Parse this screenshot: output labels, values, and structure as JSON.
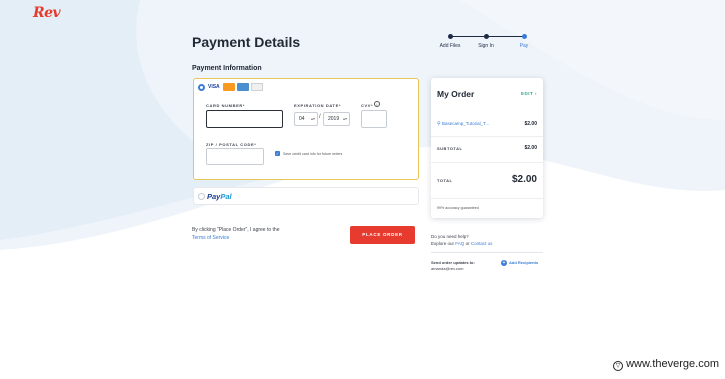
{
  "brand": {
    "logo_text": "Rev"
  },
  "steps": [
    {
      "label": "Add Files"
    },
    {
      "label": "Sign In"
    },
    {
      "label": "Pay"
    }
  ],
  "page": {
    "title": "Payment Details",
    "section": "Payment Information"
  },
  "card_form": {
    "card_brands": [
      "VISA",
      "mastercard",
      "amex",
      "discover"
    ],
    "card_number_label": "CARD NUMBER*",
    "expiration_label": "EXPIRATION DATE*",
    "exp_month": "04",
    "exp_year": "2019",
    "cvv_label": "CVV*",
    "zip_label": "ZIP / POSTAL CODE*",
    "save_label": "Save credit card info for future orders"
  },
  "paypal": {
    "pay": "Pay",
    "pal": "Pal"
  },
  "terms": {
    "text": "By clicking \"Place Order\", I agree to the",
    "link": "Terms of Service"
  },
  "place_order_label": "PLACE ORDER",
  "order": {
    "title": "My Order",
    "edit_label": "EDIT ›",
    "item_name": "Basecamp_Tutorial_T...",
    "item_amount": "$2.00",
    "subtotal_label": "SUBTOTAL",
    "subtotal_value": "$2.00",
    "total_label": "TOTAL",
    "total_value": "$2.00",
    "guarantee": "99% accuracy guaranteed"
  },
  "help": {
    "line1": "Do you need help?",
    "line2_prefix": "Explore our",
    "faq": "FAQ",
    "or": "or",
    "contact": "Contact us"
  },
  "updates": {
    "label": "Send order updates to:",
    "email": "amanda@rev.com",
    "add_recipients": "Add Recipients"
  },
  "credit": "www.theverge.com",
  "colors": {
    "accent": "#3a7bd5",
    "cta": "#e63b2e",
    "focus_border": "#e9c65b",
    "edit": "#2aa58f"
  }
}
